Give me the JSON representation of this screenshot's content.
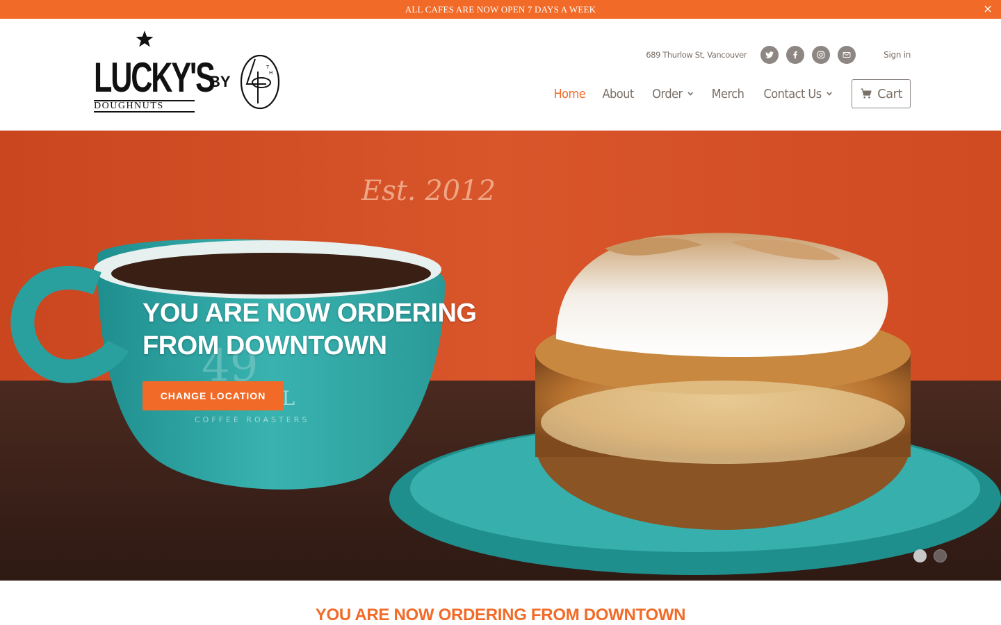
{
  "announcement": {
    "text": "ALL CAFES ARE NOW OPEN 7 DAYS A WEEK",
    "close": "×"
  },
  "brand": {
    "name": "LUCKY'S",
    "subtitle": "DOUGHNUTS",
    "by": "BY",
    "partner_mark": "49th"
  },
  "header": {
    "address": "689 Thurlow St, Vancouver",
    "social": [
      "twitter-icon",
      "facebook-icon",
      "instagram-icon",
      "email-icon"
    ],
    "signin": "Sign in"
  },
  "nav": {
    "items": [
      {
        "label": "Home",
        "active": true,
        "dropdown": false
      },
      {
        "label": "About",
        "active": false,
        "dropdown": false
      },
      {
        "label": "Order",
        "active": false,
        "dropdown": true
      },
      {
        "label": "Merch",
        "active": false,
        "dropdown": false
      },
      {
        "label": "Contact Us",
        "active": false,
        "dropdown": true
      }
    ],
    "cart": "Cart"
  },
  "hero": {
    "title": "YOU ARE NOW ORDERING FROM DOWNTOWN",
    "button": "CHANGE LOCATION",
    "background_text": "Est. 2012",
    "slides": 2,
    "active_slide": 1
  },
  "section": {
    "title": "YOU ARE NOW ORDERING FROM DOWNTOWN"
  },
  "colors": {
    "accent": "#f26a27",
    "muted": "#7a6f66",
    "teal": "#2fa7a6"
  }
}
